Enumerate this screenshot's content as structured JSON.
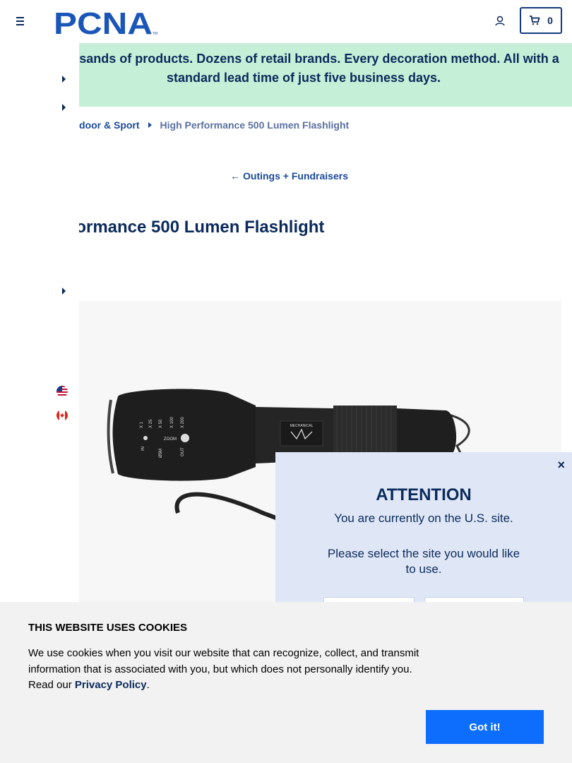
{
  "header": {
    "logo_text": "PCNA",
    "logo_tm": "TM",
    "cart_count": "0"
  },
  "promo": {
    "text": "Thousands of products. Dozens of retail brands. Every decoration method. All with a standard lead time of just five business days."
  },
  "breadcrumb": {
    "parent": "door & Sport",
    "current": "High Performance 500 Lumen Flashlight"
  },
  "back_link": {
    "arrow": "←",
    "label": "Outings + Fundraisers"
  },
  "product": {
    "title": "rformance 500 Lumen Flashlight",
    "brand_mark": "MECHANICAL",
    "zoom_markings": [
      "X 1",
      "X 25",
      "X 50",
      "X 100",
      "X 200",
      "ZOOM",
      "IN",
      "OUT",
      "Ø5M"
    ]
  },
  "modal": {
    "close": "×",
    "title": "ATTENTION",
    "line1": "You are currently on the U.S. site.",
    "line2": "Please select the site you would like to use."
  },
  "cookie": {
    "title": "THIS WEBSITE USES COOKIES",
    "text": "We use cookies when you visit our website that can recognize, collect, and transmit information that is associated with you, but which does not personally identify you. Read our ",
    "link": "Privacy Policy",
    "period": ".",
    "button": "Got it!"
  },
  "colors": {
    "navy": "#0b2a5b",
    "link_blue": "#1a4a9c",
    "promo_bg": "#c6efd7",
    "modal_bg": "#dfe7f6",
    "cookie_bg": "#f2f2f2",
    "cookie_button": "#0d6efd"
  },
  "icons": {
    "menu": "hamburger-icon",
    "account": "user-icon",
    "cart": "cart-icon",
    "us_flag": "us-flag-icon",
    "ca_flag": "canada-flag-icon"
  }
}
